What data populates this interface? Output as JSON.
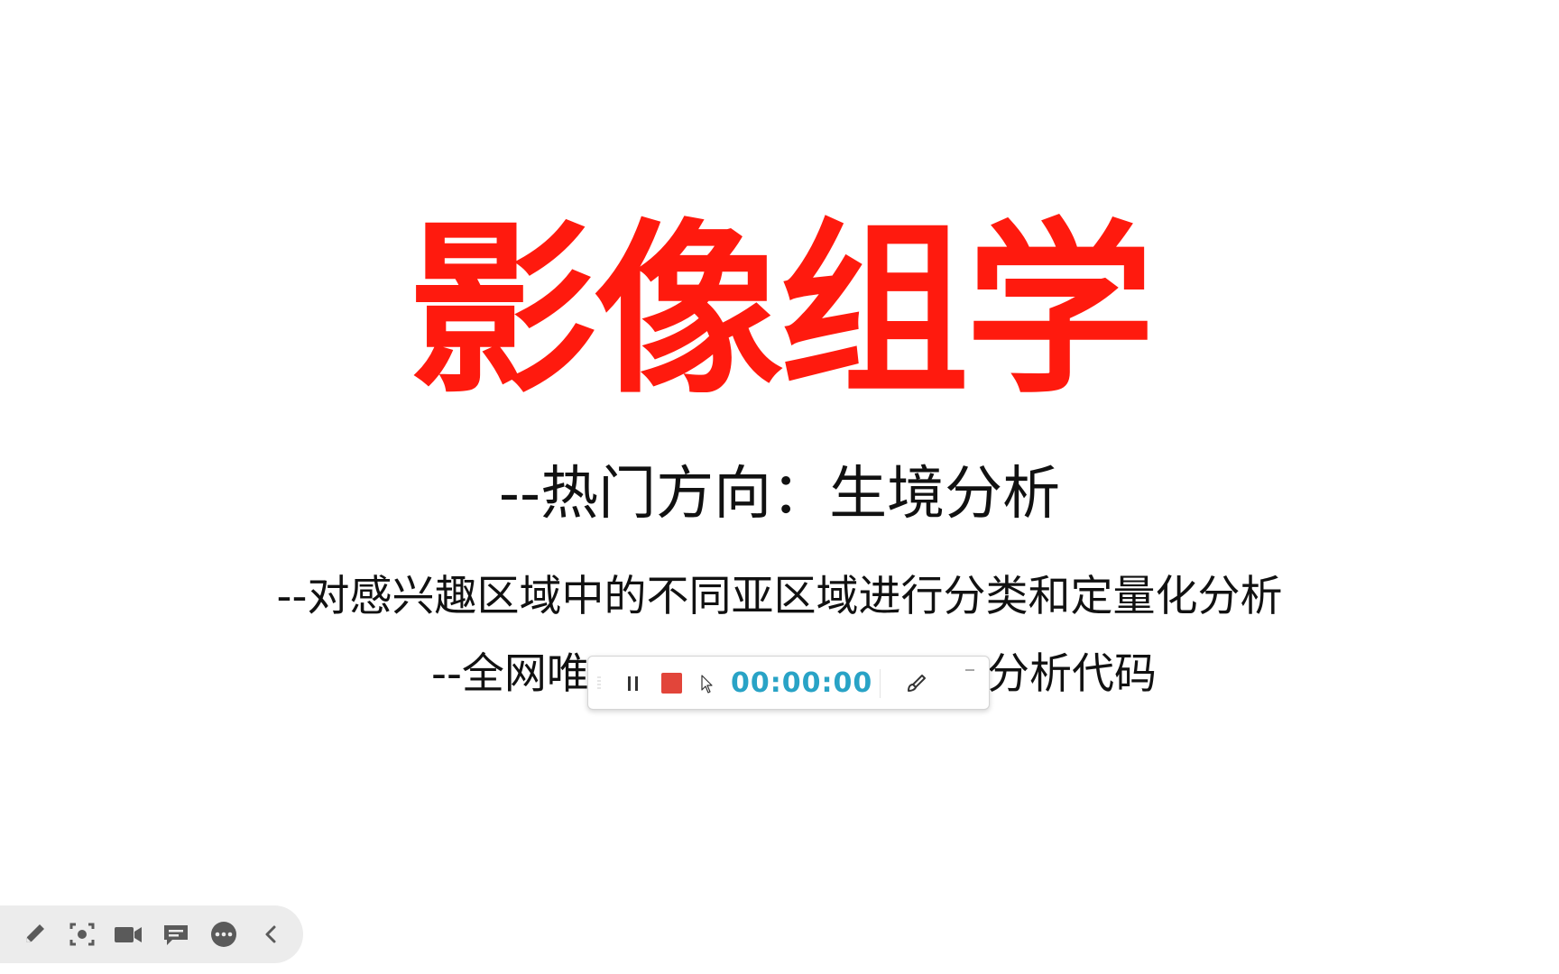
{
  "slide": {
    "title": "影像组学",
    "subtitle_1": "--热门方向：生境分析",
    "subtitle_2": "--对感兴趣区域中的不同亚区域进行分类和定量化分析",
    "subtitle_3_left": "--全网唯一",
    "subtitle_3_right": "分析代码"
  },
  "recorder": {
    "timer": "00:00:00",
    "stop_color": "#e2453a",
    "timer_color": "#29a3c6"
  },
  "colors": {
    "title": "#ff1a0e",
    "text": "#111111",
    "toolbar_bg": "#ececec",
    "icon": "#5a5a5a"
  },
  "icons": {
    "toolbar": [
      "pencil-icon",
      "screenshot-icon",
      "video-camera-icon",
      "comment-icon",
      "more-icon",
      "collapse-chevron-icon"
    ],
    "recorder": [
      "grip-icon",
      "pause-icon",
      "stop-icon",
      "cursor-icon",
      "brush-icon",
      "minimize-icon"
    ]
  }
}
